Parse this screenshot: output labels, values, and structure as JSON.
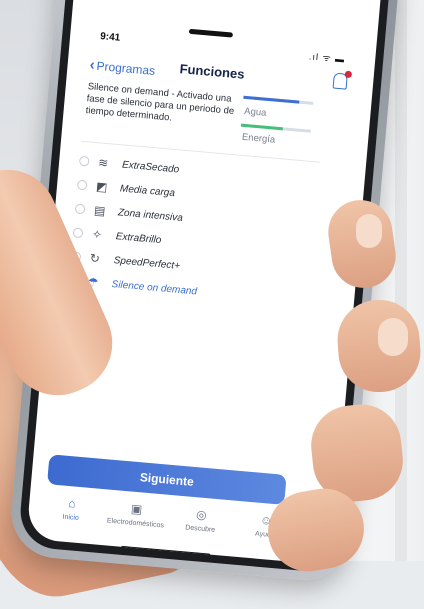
{
  "status": {
    "time": "9:41",
    "icons": ".ıl ᯤ ▬"
  },
  "header": {
    "back_label": "Programas",
    "title": "Funciones"
  },
  "description": "Silence on demand - Activado una fase de silencio para un periodo de tiempo determinado.",
  "meters": {
    "water_label": "Agua",
    "water_level": 0.8,
    "energy_label": "Energía",
    "energy_level": 0.6
  },
  "options": [
    {
      "label": "ExtraSecado",
      "icon": "dry-steam-icon",
      "selected": false
    },
    {
      "label": "Media carga",
      "icon": "half-load-icon",
      "selected": false
    },
    {
      "label": "Zona intensiva",
      "icon": "intensive-zone-icon",
      "selected": false
    },
    {
      "label": "ExtraBrillo",
      "icon": "shine-icon",
      "selected": false
    },
    {
      "label": "SpeedPerfect+",
      "icon": "speed-icon",
      "selected": false
    },
    {
      "label": "Silence on demand",
      "icon": "silence-icon",
      "selected": true
    }
  ],
  "next_button": "Siguiente",
  "tabs": [
    {
      "label": "Inicio",
      "icon": "home-icon",
      "active": true
    },
    {
      "label": "Electrodomésticos",
      "icon": "appliance-icon",
      "active": false
    },
    {
      "label": "Descubre",
      "icon": "compass-icon",
      "active": false
    },
    {
      "label": "Ayuda",
      "icon": "help-icon",
      "active": false
    }
  ],
  "colors": {
    "accent": "#3a6fcf",
    "energy": "#45c07a",
    "notification": "#d8273a"
  }
}
